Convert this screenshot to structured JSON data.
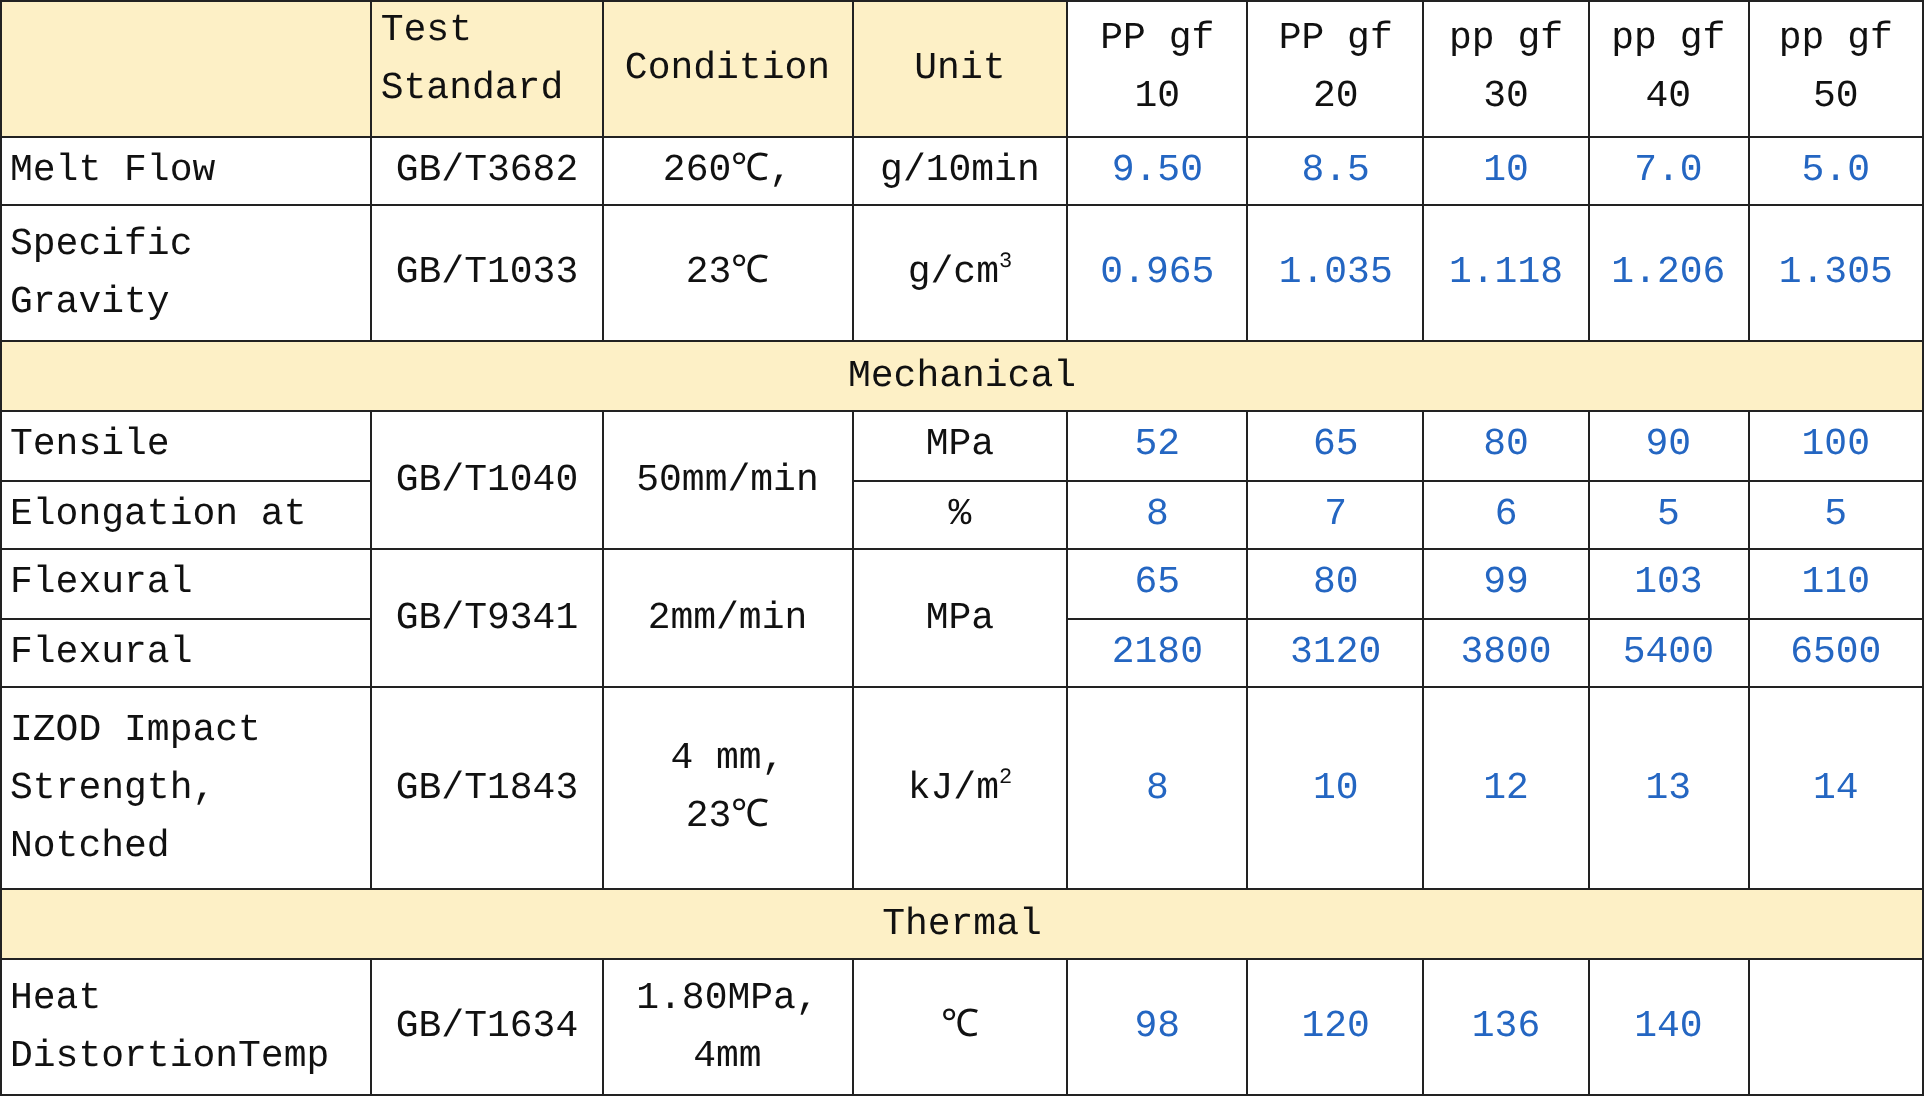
{
  "table": {
    "columns": [
      "",
      "Test Standard",
      "Condition",
      "Unit",
      "PP gf 10",
      "PP gf 20",
      "pp gf 30",
      "pp gf 40",
      "pp gf 50"
    ],
    "blocks": [
      {
        "kind": "group",
        "standard": "GB/T3682",
        "condition": "260℃,",
        "rows": [
          {
            "property": "Melt Flow",
            "unit": "g/10min",
            "values": [
              "9.50",
              "8.5",
              "10",
              "7.0",
              "5.0"
            ]
          }
        ]
      },
      {
        "kind": "group",
        "standard": "GB/T1033",
        "condition": "23℃",
        "rows": [
          {
            "property": "Specific Gravity",
            "unit": "g/cm$^{3}$",
            "values": [
              "0.965",
              "1.035",
              "1.118",
              "1.206",
              "1.305"
            ]
          }
        ]
      },
      {
        "kind": "section",
        "title": "Mechanical"
      },
      {
        "kind": "group",
        "standard": "GB/T1040",
        "condition": "50mm/min",
        "rows": [
          {
            "property": "Tensile",
            "unit": "MPa",
            "values": [
              "52",
              "65",
              "80",
              "90",
              "100"
            ]
          },
          {
            "property": "Elongation at",
            "unit": "%",
            "values": [
              "8",
              "7",
              "6",
              "5",
              "5"
            ]
          }
        ]
      },
      {
        "kind": "group",
        "standard": "GB/T9341",
        "condition": "2mm/min",
        "unit": "MPa",
        "rows": [
          {
            "property": "Flexural",
            "values": [
              "65",
              "80",
              "99",
              "103",
              "110"
            ]
          },
          {
            "property": "Flexural",
            "values": [
              "2180",
              "3120",
              "3800",
              "5400",
              "6500"
            ]
          }
        ]
      },
      {
        "kind": "group",
        "standard": "GB/T1843",
        "condition": "4 mm, 23℃",
        "rows": [
          {
            "property": "IZOD Impact Strength, Notched",
            "unit": "kJ/m$^{2}$",
            "values": [
              "8",
              "10",
              "12",
              "13",
              "14"
            ]
          }
        ]
      },
      {
        "kind": "section",
        "title": "Thermal"
      },
      {
        "kind": "group",
        "standard": "GB/T1634",
        "condition": "1.80MPa, 4mm",
        "rows": [
          {
            "property": "Heat DistortionTemp",
            "unit": "℃",
            "values": [
              "98",
              "120",
              "136",
              "140"
            ]
          }
        ]
      }
    ]
  }
}
